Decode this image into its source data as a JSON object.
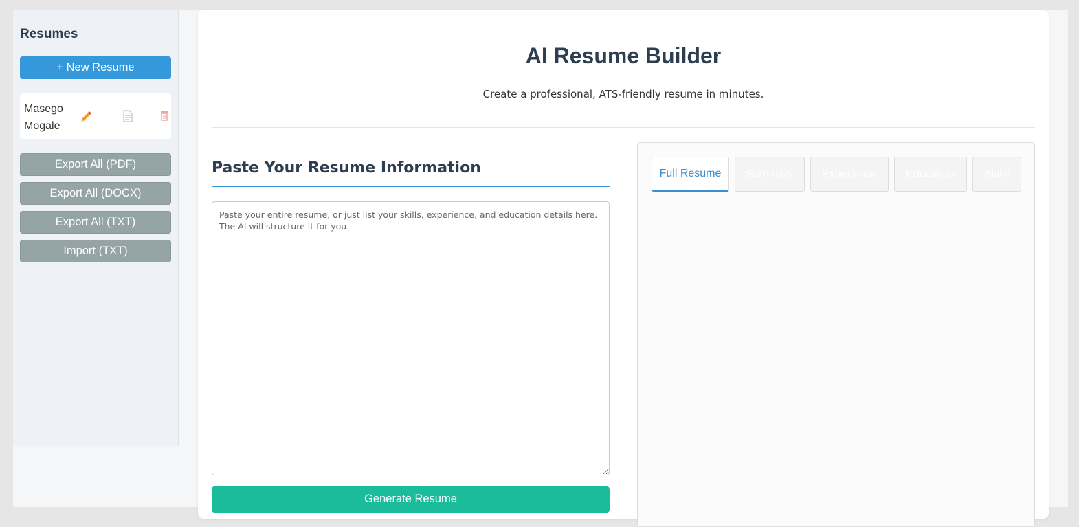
{
  "sidebar": {
    "title": "Resumes",
    "new_button": "+ New Resume",
    "resumes": [
      {
        "name": "Masego Mogale"
      }
    ],
    "icons": [
      "pencil-icon",
      "document-icon",
      "trash-icon"
    ],
    "buttons": {
      "export_pdf": "Export All (PDF)",
      "export_docx": "Export All (DOCX)",
      "export_txt": "Export All (TXT)",
      "import_txt": "Import (TXT)"
    }
  },
  "header": {
    "title": "AI Resume Builder",
    "subtitle": "Create a professional, ATS-friendly resume in minutes."
  },
  "input_section": {
    "title": "Paste Your Resume Information",
    "placeholder": "Paste your entire resume, or just list your skills, experience, and education details here. The AI will structure it for you.",
    "value": "",
    "generate_button": "Generate Resume"
  },
  "preview": {
    "tabs": [
      {
        "label": "Full Resume",
        "active": true
      },
      {
        "label": "Summary",
        "active": false
      },
      {
        "label": "Experience",
        "active": false
      },
      {
        "label": "Education",
        "active": false
      },
      {
        "label": "Skills",
        "active": false
      }
    ]
  },
  "colors": {
    "primary": "#3498db",
    "secondary_button": "#95a5a6",
    "generate": "#1abc9c",
    "heading": "#2c3e50"
  }
}
